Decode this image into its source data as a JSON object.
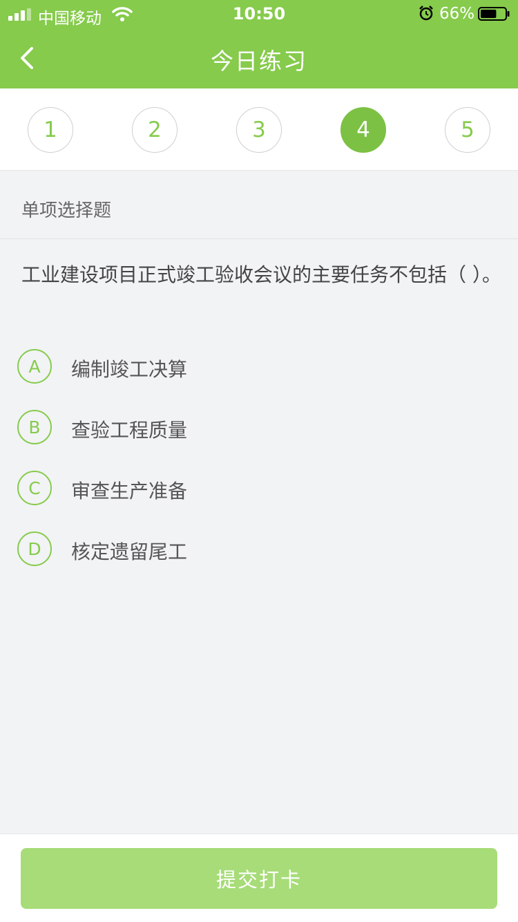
{
  "status_bar": {
    "carrier": "中国移动",
    "time": "10:50",
    "battery_percent": "66%",
    "battery_level": 0.66,
    "icons": [
      "signal-icon",
      "wifi-icon",
      "alarm-icon",
      "battery-icon"
    ]
  },
  "nav": {
    "title": "今日练习",
    "back_icon": "chevron-left-icon"
  },
  "question_nav": {
    "items": [
      "1",
      "2",
      "3",
      "4",
      "5"
    ],
    "active": "4"
  },
  "question": {
    "type_label": "单项选择题",
    "text": "工业建设项目正式竣工验收会议的主要任务不包括（ ）。",
    "options": [
      {
        "letter": "A",
        "text": "编制竣工决算"
      },
      {
        "letter": "B",
        "text": "查验工程质量"
      },
      {
        "letter": "C",
        "text": "审查生产准备"
      },
      {
        "letter": "D",
        "text": "核定遗留尾工"
      }
    ]
  },
  "footer": {
    "submit_label": "提交打卡"
  },
  "colors": {
    "brand": "#86cb4c",
    "active": "#7cc144",
    "submit": "#a7dc78",
    "background": "#f2f3f5"
  }
}
